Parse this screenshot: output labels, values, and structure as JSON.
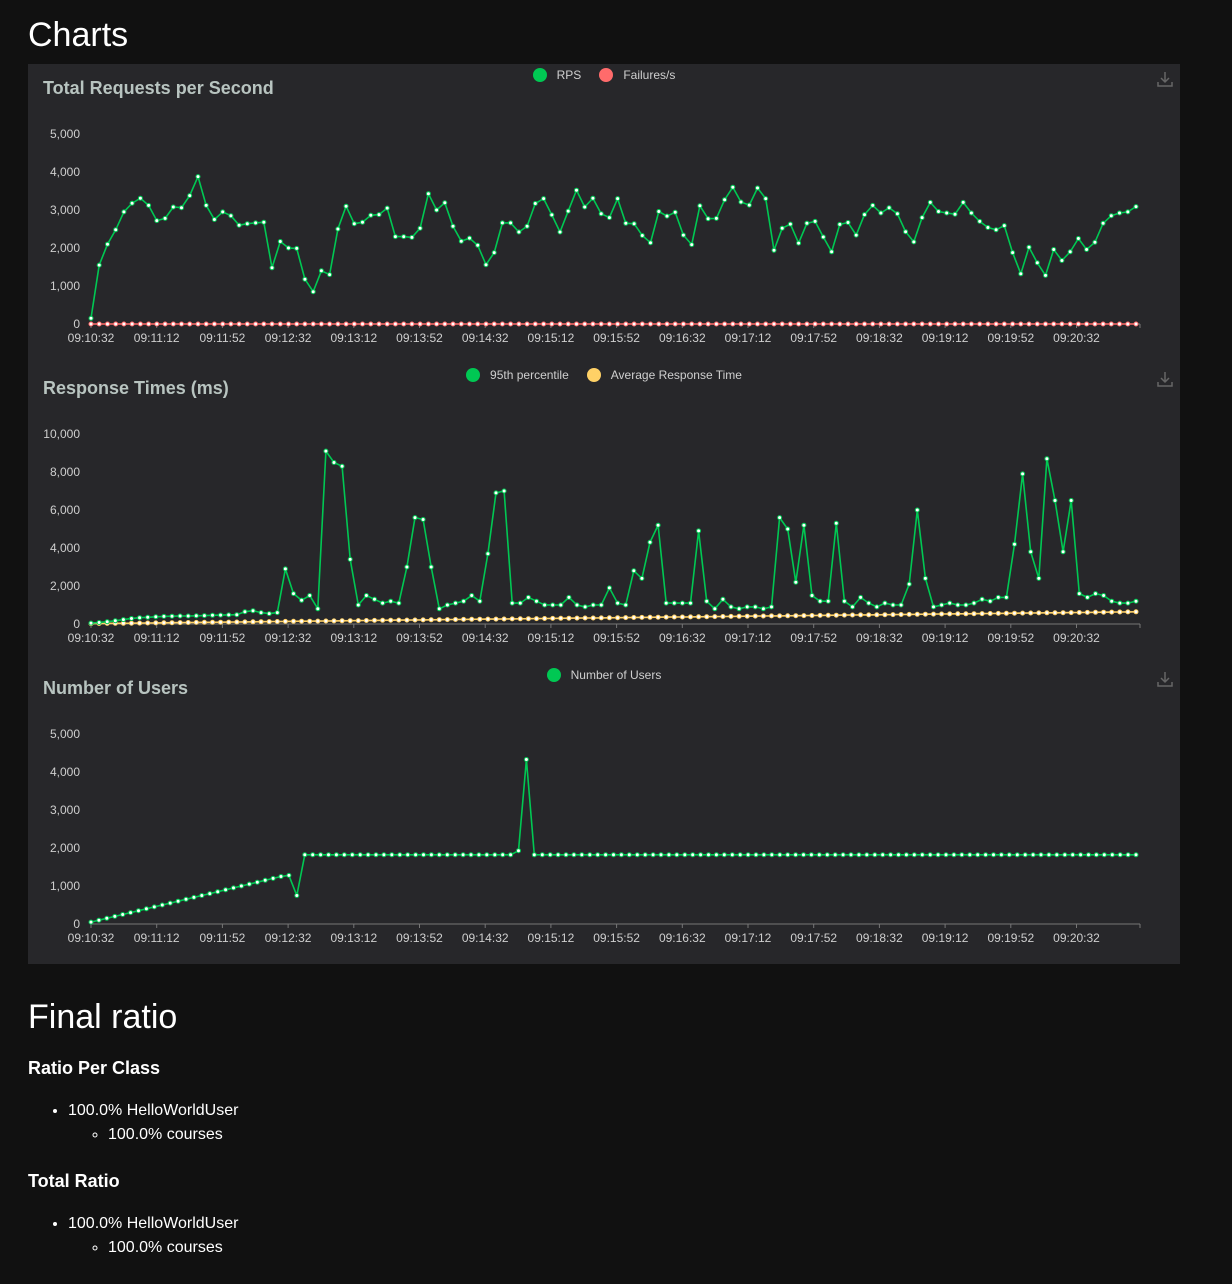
{
  "headings": {
    "charts": "Charts",
    "final_ratio": "Final ratio"
  },
  "x_ticks": [
    "09:10:32",
    "09:11:12",
    "09:11:52",
    "09:12:32",
    "09:13:12",
    "09:13:52",
    "09:14:32",
    "09:15:12",
    "09:15:52",
    "09:16:32",
    "09:17:12",
    "09:17:52",
    "09:18:32",
    "09:19:12",
    "09:19:52",
    "09:20:32"
  ],
  "chart_data": [
    {
      "type": "line",
      "title": "Total Requests per Second",
      "ylim": [
        0,
        5000
      ],
      "yticks": [
        "0",
        "1,000",
        "2,000",
        "3,000",
        "4,000",
        "5,000"
      ],
      "grid": false,
      "legend_placement": "top-center",
      "series": [
        {
          "name": "RPS",
          "color": "#00c853",
          "values": [
            150,
            1550,
            2100,
            2480,
            2950,
            3180,
            3310,
            3120,
            2720,
            2780,
            3080,
            3060,
            3380,
            3880,
            3120,
            2750,
            2950,
            2850,
            2600,
            2640,
            2660,
            2680,
            1480,
            2170,
            2000,
            1990,
            1180,
            850,
            1400,
            1300,
            2500,
            3100,
            2640,
            2680,
            2860,
            2880,
            3050,
            2300,
            2300,
            2280,
            2520,
            3430,
            3000,
            3190,
            2570,
            2180,
            2260,
            2070,
            1560,
            1880,
            2660,
            2660,
            2420,
            2570,
            3170,
            3300,
            2870,
            2420,
            2970,
            3520,
            3080,
            3310,
            2900,
            2800,
            3300,
            2650,
            2640,
            2330,
            2140,
            2960,
            2840,
            2940,
            2340,
            2090,
            3110,
            2770,
            2780,
            3270,
            3600,
            3210,
            3130,
            3580,
            3300,
            1940,
            2520,
            2630,
            2130,
            2650,
            2700,
            2290,
            1900,
            2620,
            2670,
            2340,
            2880,
            3120,
            2920,
            3060,
            2900,
            2430,
            2160,
            2800,
            3200,
            2960,
            2920,
            2890,
            3200,
            2920,
            2700,
            2540,
            2480,
            2590,
            1880,
            1320,
            2020,
            1610,
            1280,
            1960,
            1670,
            1900,
            2250,
            1960,
            2150,
            2650,
            2850,
            2920,
            2950,
            3090
          ]
        },
        {
          "name": "Failures/s",
          "color": "#ff6b6b",
          "values_constant": 0
        }
      ]
    },
    {
      "type": "line",
      "title": "Response Times (ms)",
      "ylim": [
        0,
        10000
      ],
      "yticks": [
        "0",
        "2,000",
        "4,000",
        "6,000",
        "8,000",
        "10,000"
      ],
      "grid": false,
      "legend_placement": "top-center",
      "series": [
        {
          "name": "95th percentile",
          "color": "#00c853",
          "values": [
            50,
            80,
            120,
            170,
            230,
            290,
            330,
            350,
            380,
            400,
            410,
            420,
            420,
            430,
            440,
            460,
            470,
            480,
            490,
            650,
            700,
            600,
            550,
            600,
            2900,
            1600,
            1250,
            1500,
            800,
            9100,
            8500,
            8300,
            3400,
            1000,
            1500,
            1300,
            1100,
            1200,
            1100,
            3000,
            5600,
            5500,
            3000,
            800,
            1000,
            1100,
            1200,
            1500,
            1200,
            3700,
            6900,
            7000,
            1100,
            1100,
            1400,
            1200,
            1000,
            1000,
            1000,
            1400,
            1000,
            900,
            1000,
            1000,
            1900,
            1100,
            1000,
            2800,
            2400,
            4300,
            5200,
            1100,
            1100,
            1100,
            1100,
            4900,
            1200,
            800,
            1300,
            900,
            800,
            900,
            900,
            800,
            900,
            5600,
            5000,
            2200,
            5200,
            1500,
            1200,
            1200,
            5300,
            1200,
            900,
            1400,
            1100,
            900,
            1100,
            1000,
            1000,
            2100,
            6000,
            2400,
            900,
            1000,
            1100,
            1000,
            1000,
            1100,
            1300,
            1200,
            1400,
            1400,
            4200,
            7900,
            3800,
            2400,
            8700,
            6500,
            3800,
            6500,
            1600,
            1400,
            1600,
            1500,
            1200,
            1100,
            1100,
            1200
          ]
        },
        {
          "name": "Average Response Time",
          "color": "#ffd166",
          "ramp": [
            20,
            640
          ]
        }
      ]
    },
    {
      "type": "line",
      "title": "Number of Users",
      "ylim": [
        0,
        5000
      ],
      "yticks": [
        "0",
        "1,000",
        "2,000",
        "3,000",
        "4,000",
        "5,000"
      ],
      "grid": false,
      "legend_placement": "top-center",
      "series": [
        {
          "name": "Number of Users",
          "color": "#00c853",
          "values": [
            50,
            100,
            150,
            200,
            250,
            300,
            350,
            400,
            450,
            500,
            550,
            600,
            650,
            700,
            750,
            800,
            850,
            900,
            950,
            1000,
            1050,
            1100,
            1150,
            1200,
            1250,
            1280,
            750,
            1820,
            1820,
            1820,
            1820,
            1820,
            1820,
            1820,
            1820,
            1820,
            1820,
            1820,
            1820,
            1820,
            1820,
            1820,
            1820,
            1820,
            1820,
            1820,
            1820,
            1820,
            1820,
            1820,
            1820,
            1820,
            1820,
            1820,
            1930,
            4330,
            1820,
            1820,
            1820,
            1820,
            1820,
            1820,
            1820,
            1820,
            1820,
            1820,
            1820,
            1820,
            1820,
            1820,
            1820,
            1820,
            1820,
            1820,
            1820,
            1820,
            1820,
            1820,
            1820,
            1820,
            1820,
            1820,
            1820,
            1820,
            1820,
            1820,
            1820,
            1820,
            1820,
            1820,
            1820,
            1820,
            1820,
            1820,
            1820,
            1820,
            1820,
            1820,
            1820,
            1820,
            1820,
            1820,
            1820,
            1820,
            1820,
            1820,
            1820,
            1820,
            1820,
            1820,
            1820,
            1820,
            1820,
            1820,
            1820,
            1820,
            1820,
            1820,
            1820,
            1820,
            1820,
            1820,
            1820,
            1820,
            1820,
            1820,
            1820,
            1820,
            1820,
            1820,
            1820,
            1820,
            1820
          ]
        }
      ]
    }
  ],
  "final_ratio": {
    "per_class_heading": "Ratio Per Class",
    "total_heading": "Total Ratio",
    "per_class": {
      "user": "100.0% HelloWorldUser",
      "task": "100.0% courses"
    },
    "total": {
      "user": "100.0% HelloWorldUser",
      "task": "100.0% courses"
    }
  },
  "icons": {
    "download": "download-icon"
  }
}
